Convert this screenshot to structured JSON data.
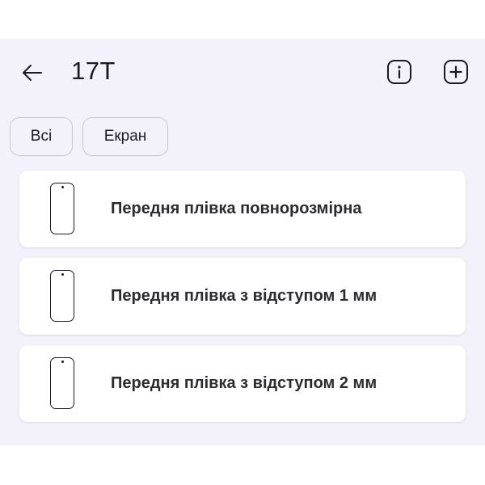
{
  "header": {
    "back_icon": "arrow-left-icon",
    "title": "17T",
    "info_icon": "info-icon",
    "add_icon": "add-icon"
  },
  "filters": [
    {
      "label": "Всі",
      "selected": false
    },
    {
      "label": "Екран",
      "selected": false
    }
  ],
  "items": [
    {
      "icon": "phone-outline-icon",
      "label": "Передня плівка повнорозмірна"
    },
    {
      "icon": "phone-outline-icon",
      "label": "Передня плівка з відступом 1 мм"
    },
    {
      "icon": "phone-outline-icon",
      "label": "Передня плівка з відступом 2 мм"
    }
  ],
  "colors": {
    "background": "#f3f2fb",
    "card": "#ffffff",
    "text": "#1b1b1f",
    "chip_border": "#c9c7d2"
  }
}
